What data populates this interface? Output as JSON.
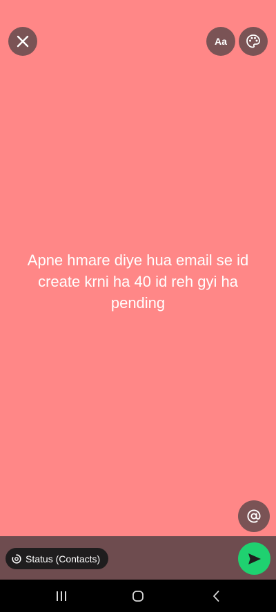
{
  "toolbar": {
    "close_icon": "close-icon",
    "font_label": "Aa",
    "palette_icon": "palette-icon"
  },
  "status": {
    "text": "Apne hmare diye hua email se id create krni ha 40 id reh gyi ha pending",
    "background_color": "#ff8787",
    "text_color": "#ffffff"
  },
  "mention": {
    "icon": "at-sign-icon"
  },
  "composer": {
    "audience_label": "Status (Contacts)",
    "audience_icon": "status-icon",
    "send_icon": "send-icon",
    "send_color": "#1fd170"
  },
  "system_nav": {
    "recent_icon": "recent-apps-icon",
    "home_icon": "home-icon",
    "back_icon": "back-icon"
  }
}
